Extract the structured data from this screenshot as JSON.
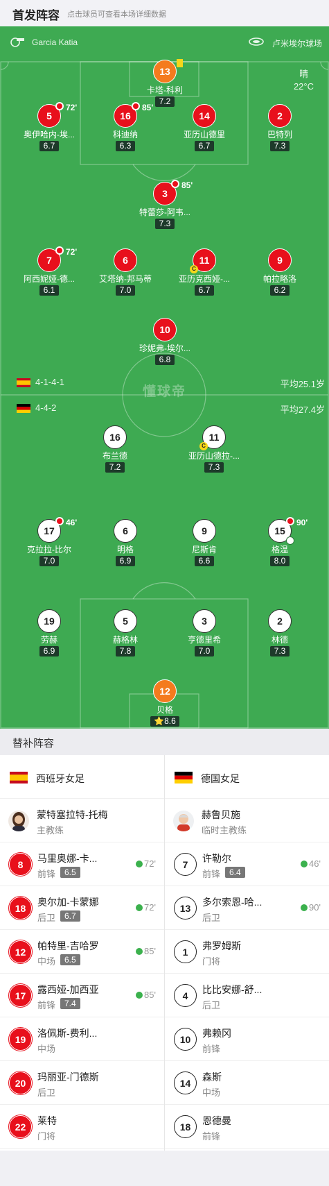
{
  "header": {
    "title": "首发阵容",
    "hint": "点击球员可查看本场详细数据"
  },
  "match": {
    "referee": "Garcia Katia",
    "venue": "卢米埃尔球场",
    "weather": "晴",
    "temperature": "22°C",
    "watermark": "懂球帝"
  },
  "home": {
    "formation": "4-1-4-1",
    "avg_age": "平均25.1岁"
  },
  "away": {
    "formation": "4-4-2",
    "avg_age": "平均27.4岁"
  },
  "home_players": [
    {
      "num": "13",
      "name": "卡塔-科利",
      "rating": "7.2"
    },
    {
      "num": "5",
      "name": "奥伊哈内-埃...",
      "rating": "6.7",
      "sub_min": "72'"
    },
    {
      "num": "16",
      "name": "科迪纳",
      "rating": "6.3",
      "sub_min": "85'"
    },
    {
      "num": "14",
      "name": "亚历山德里",
      "rating": "6.7"
    },
    {
      "num": "2",
      "name": "巴特列",
      "rating": "7.3"
    },
    {
      "num": "3",
      "name": "特蕾莎-阿韦...",
      "rating": "7.3",
      "sub_min": "85'"
    },
    {
      "num": "7",
      "name": "阿西妮娅-德...",
      "rating": "6.1",
      "sub_min": "72'"
    },
    {
      "num": "6",
      "name": "艾塔纳-邦马蒂",
      "rating": "7.0"
    },
    {
      "num": "11",
      "name": "亚历克西娅-...",
      "rating": "6.7"
    },
    {
      "num": "9",
      "name": "帕拉略洛",
      "rating": "6.2"
    },
    {
      "num": "10",
      "name": "珍妮弗-埃尔...",
      "rating": "6.8"
    }
  ],
  "away_players": [
    {
      "num": "16",
      "name": "布兰德",
      "rating": "7.2"
    },
    {
      "num": "11",
      "name": "亚历山德拉-...",
      "rating": "7.3"
    },
    {
      "num": "17",
      "name": "克拉拉-比尔",
      "rating": "7.0",
      "sub_min": "46'"
    },
    {
      "num": "6",
      "name": "明格",
      "rating": "6.9"
    },
    {
      "num": "9",
      "name": "尼斯肯",
      "rating": "6.6"
    },
    {
      "num": "15",
      "name": "格温",
      "rating": "8.0",
      "sub_min": "90'"
    },
    {
      "num": "19",
      "name": "劳赫",
      "rating": "6.9"
    },
    {
      "num": "5",
      "name": "赫格林",
      "rating": "7.8"
    },
    {
      "num": "3",
      "name": "亨德里希",
      "rating": "7.0"
    },
    {
      "num": "2",
      "name": "林德",
      "rating": "7.3"
    },
    {
      "num": "12",
      "name": "贝格",
      "rating": "8.6",
      "star": "⭐"
    }
  ],
  "subs": {
    "title": "替补阵容",
    "home_team": "西班牙女足",
    "away_team": "德国女足",
    "home_coach": {
      "name": "蒙特塞拉特-托梅",
      "role": "主教练"
    },
    "away_coach": {
      "name": "赫鲁贝施",
      "role": "临时主教练"
    },
    "home": [
      {
        "num": "8",
        "name": "马里奥娜-卡...",
        "pos": "前锋",
        "rating": "6.5",
        "min": "72'"
      },
      {
        "num": "18",
        "name": "奥尔加-卡蒙娜",
        "pos": "后卫",
        "rating": "6.7",
        "min": "72'"
      },
      {
        "num": "12",
        "name": "帕特里-吉哈罗",
        "pos": "中场",
        "rating": "6.5",
        "min": "85'"
      },
      {
        "num": "17",
        "name": "露西娅-加西亚",
        "pos": "前锋",
        "rating": "7.4",
        "min": "85'"
      },
      {
        "num": "19",
        "name": "洛佩斯-费利...",
        "pos": "中场"
      },
      {
        "num": "20",
        "name": "玛丽亚-门德斯",
        "pos": "后卫"
      },
      {
        "num": "22",
        "name": "莱特",
        "pos": "门将"
      }
    ],
    "away": [
      {
        "num": "7",
        "name": "许勒尔",
        "pos": "前锋",
        "rating": "6.4",
        "min": "46'"
      },
      {
        "num": "13",
        "name": "多尔索恩-哈...",
        "pos": "后卫",
        "min": "90'"
      },
      {
        "num": "1",
        "name": "弗罗姆斯",
        "pos": "门将"
      },
      {
        "num": "4",
        "name": "比比安娜-舒...",
        "pos": "后卫"
      },
      {
        "num": "10",
        "name": "弗赖冈",
        "pos": "前锋"
      },
      {
        "num": "14",
        "name": "森斯",
        "pos": "中场"
      },
      {
        "num": "18",
        "name": "恩德曼",
        "pos": "前锋"
      }
    ]
  },
  "colors": {
    "pitch": "#3eaa52",
    "home_shirt": "#e8101c",
    "keeper_shirt": "#f47b1e",
    "away_shirt": "#ffffff"
  }
}
